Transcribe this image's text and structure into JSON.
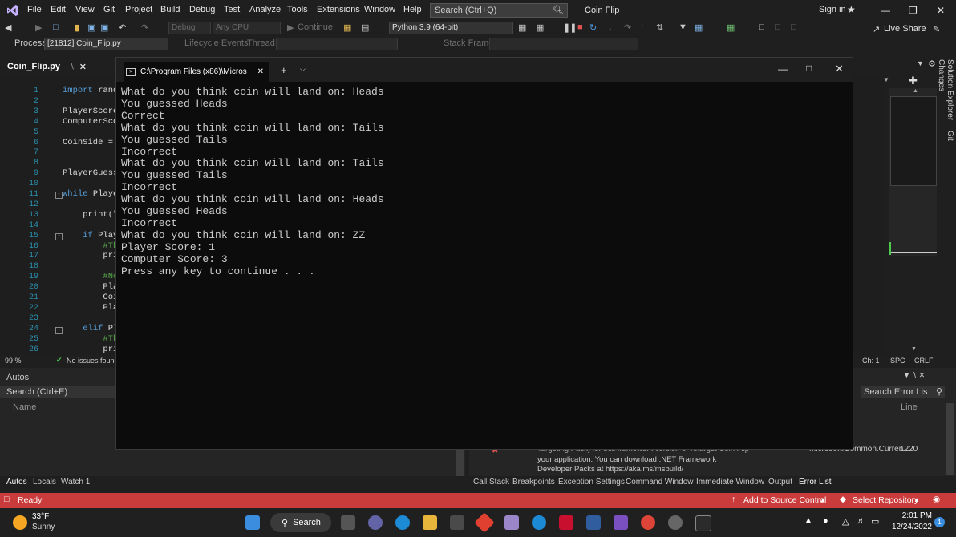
{
  "menu": {
    "items": [
      "File",
      "Edit",
      "View",
      "Git",
      "Project",
      "Build",
      "Debug",
      "Test",
      "Analyze",
      "Tools",
      "Extensions",
      "Window",
      "Help"
    ],
    "search_placeholder": "Search (Ctrl+Q)",
    "solution_title": "Coin Flip",
    "signin": "Sign in"
  },
  "toolbar": {
    "config": "Debug",
    "platform": "Any CPU",
    "continue": "Continue",
    "python": "Python 3.9 (64-bit)",
    "live_share": "Live Share"
  },
  "process_bar": {
    "process_label": "Process:",
    "process_value": "[21812] Coin_Flip.py",
    "lifecycle": "Lifecycle Events",
    "thread_label": "Thread:",
    "stack_frame_label": "Stack Frame:"
  },
  "editor": {
    "tab_name": "Coin_Flip.py",
    "line_numbers": [
      "1",
      "2",
      "3",
      "4",
      "5",
      "6",
      "7",
      "8",
      "9",
      "10",
      "11",
      "12",
      "13",
      "14",
      "15",
      "16",
      "17",
      "18",
      "19",
      "20",
      "21",
      "22",
      "23",
      "24",
      "25",
      "26"
    ],
    "code_lines": [
      {
        "line": 1,
        "text": "import rand",
        "cls": "kw-first"
      },
      {
        "line": 3,
        "text": "PlayerScore",
        "cls": ""
      },
      {
        "line": 4,
        "text": "ComputerSco",
        "cls": ""
      },
      {
        "line": 6,
        "text": "CoinSide = ",
        "cls": ""
      },
      {
        "line": 9,
        "text": "PlayerGuess",
        "cls": ""
      },
      {
        "line": 11,
        "text": "while Playe",
        "cls": "kw-first"
      },
      {
        "line": 13,
        "text": "    print(\"",
        "cls": ""
      },
      {
        "line": 15,
        "text": "    if Play",
        "cls": "kw-second"
      },
      {
        "line": 16,
        "text": "        #Th",
        "cls": "cm"
      },
      {
        "line": 17,
        "text": "        pri",
        "cls": ""
      },
      {
        "line": 19,
        "text": "        #No",
        "cls": "cm"
      },
      {
        "line": 20,
        "text": "        Pla",
        "cls": ""
      },
      {
        "line": 21,
        "text": "        Coi",
        "cls": ""
      },
      {
        "line": 22,
        "text": "        Pla",
        "cls": ""
      },
      {
        "line": 24,
        "text": "    elif Pl",
        "cls": "kw-second"
      },
      {
        "line": 25,
        "text": "        #Th",
        "cls": "cm"
      },
      {
        "line": 26,
        "text": "        pri",
        "cls": ""
      }
    ],
    "zoom": "99 %",
    "issues": "No issues found",
    "col": "Ch: 1",
    "spc": "SPC",
    "crlf": "CRLF"
  },
  "autos": {
    "title": "Autos",
    "search": "Search (Ctrl+E)",
    "column_name": "Name",
    "tabs": [
      "Autos",
      "Locals",
      "Watch 1"
    ]
  },
  "error_list": {
    "search": "Search Error Lis",
    "column_line": "Line",
    "message_lines": [
      "Targeting Pack) for this framework version or retarget Coin Flip",
      "your application. You can download .NET Framework",
      "Developer Packs at https://aka.ms/msbuild/"
    ],
    "file": "Microsoft.Common.Curren...",
    "line": "1220",
    "tabs": [
      "Call Stack",
      "Breakpoints",
      "Exception Settings",
      "Command Window",
      "Immediate Window",
      "Output",
      "Error List"
    ]
  },
  "console": {
    "tab_title": "C:\\Program Files (x86)\\Micros",
    "lines": [
      "What do you think coin will land on: Heads",
      "You guessed Heads",
      "Correct",
      "What do you think coin will land on: Tails",
      "You guessed Tails",
      "Incorrect",
      "What do you think coin will land on: Tails",
      "You guessed Tails",
      "Incorrect",
      "What do you think coin will land on: Heads",
      "You guessed Heads",
      "Incorrect",
      "What do you think coin will land on: ZZ",
      "Player Score: 1",
      "Computer Score: 3",
      "Press any key to continue . . . "
    ]
  },
  "statusbar": {
    "ready": "Ready",
    "source_control": "Add to Source Control",
    "repository": "Select Repository",
    "color": "#ca3b3b"
  },
  "taskbar": {
    "weather_temp": "33°F",
    "weather_desc": "Sunny",
    "search": "Search",
    "time": "2:01 PM",
    "date": "12/24/2022"
  },
  "side_tabs": [
    "Solution Explorer",
    "Git Changes"
  ]
}
